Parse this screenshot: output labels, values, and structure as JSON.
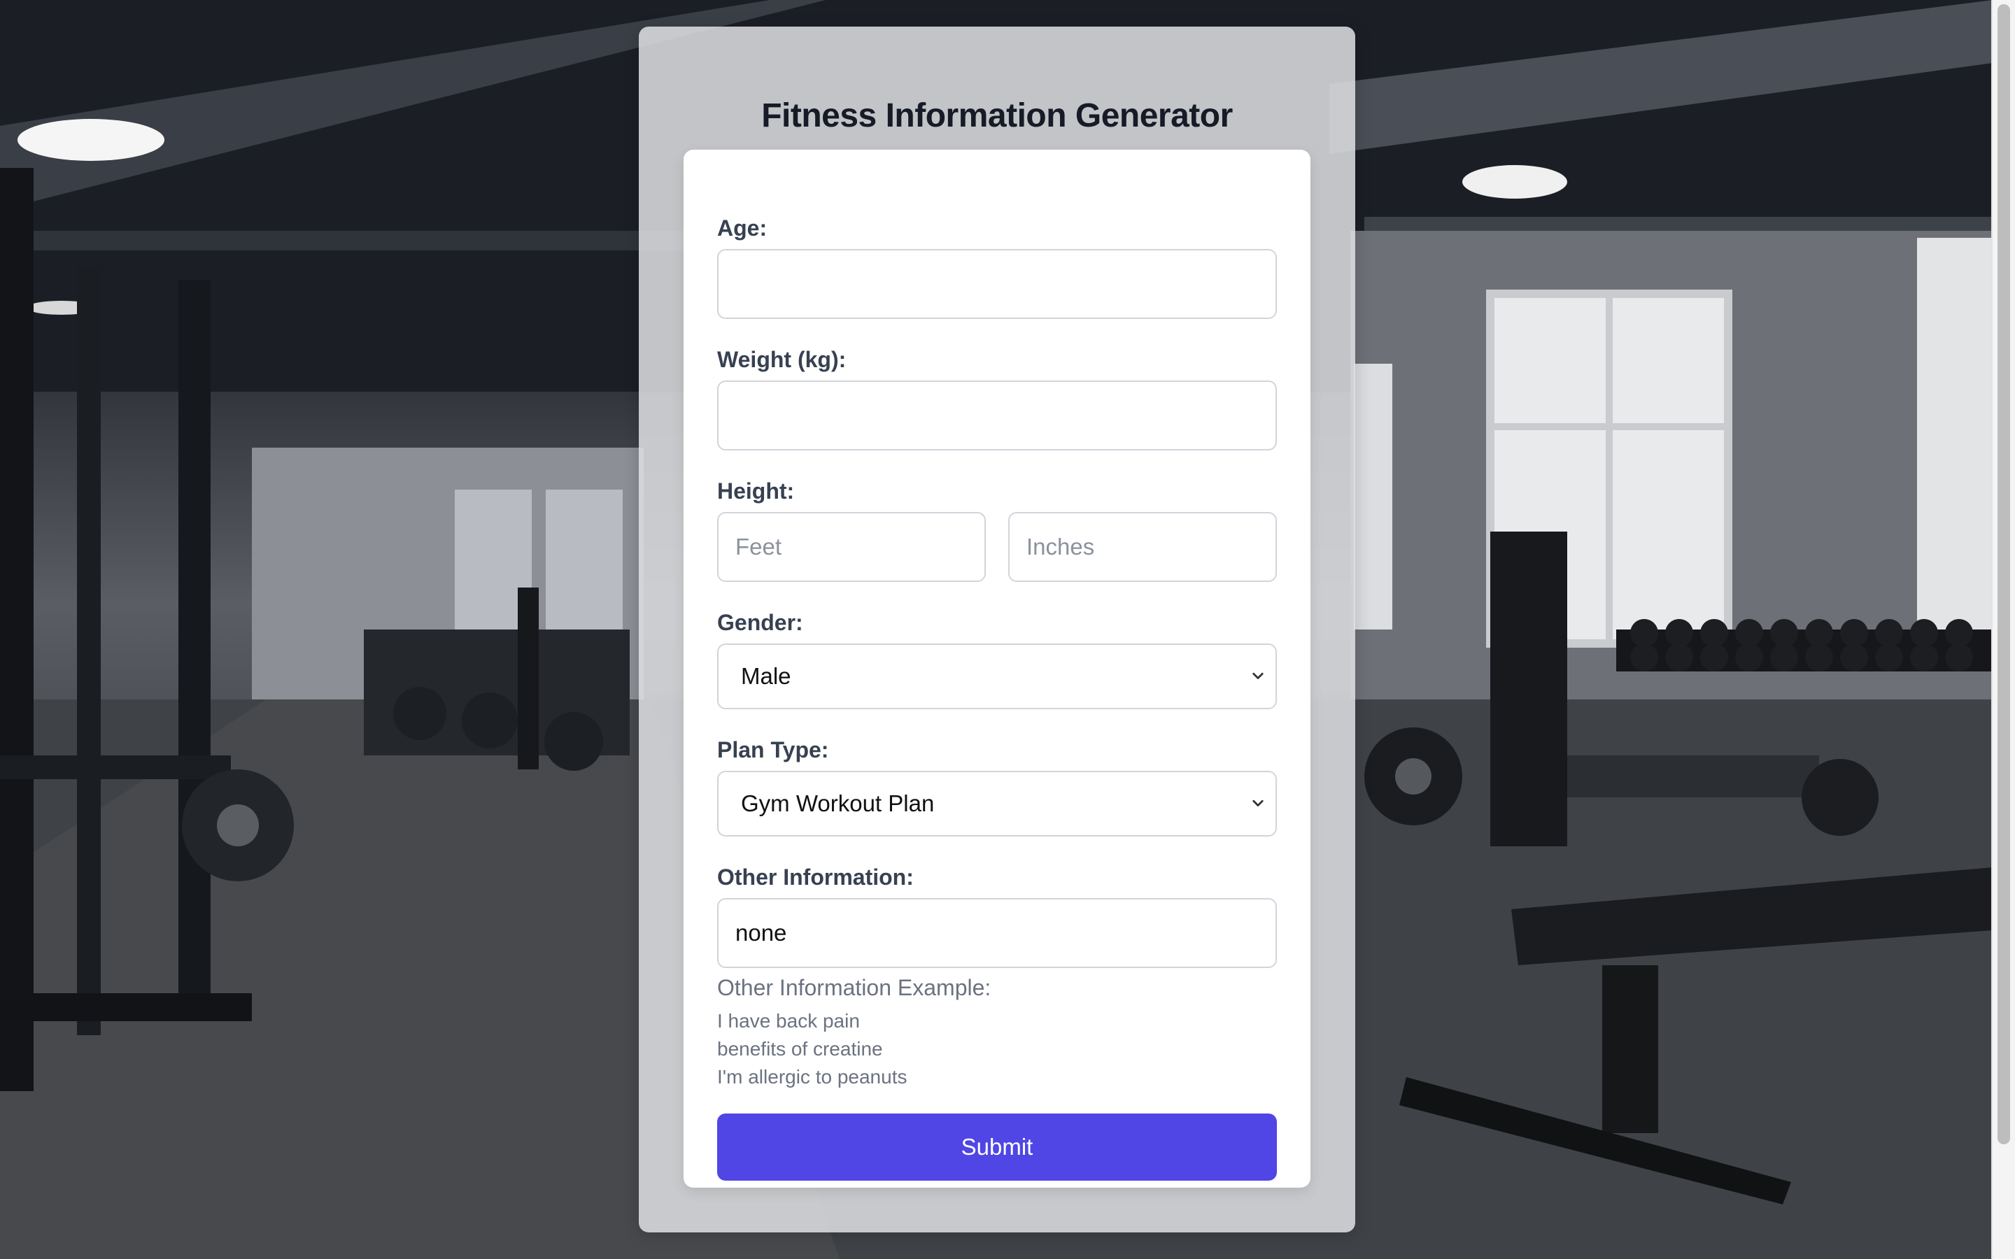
{
  "app": {
    "title": "Fitness Information Generator"
  },
  "form": {
    "age": {
      "label": "Age:",
      "value": ""
    },
    "weight": {
      "label": "Weight (kg):",
      "value": ""
    },
    "height": {
      "label": "Height:",
      "feet_placeholder": "Feet",
      "inches_placeholder": "Inches"
    },
    "gender": {
      "label": "Gender:",
      "selected": "Male"
    },
    "plan_type": {
      "label": "Plan Type:",
      "selected": "Gym Workout Plan"
    },
    "other": {
      "label": "Other Information:",
      "value": "none",
      "example_title": "Other Information Example:",
      "examples": [
        "I have back pain",
        "benefits of creatine",
        "I'm allergic to peanuts"
      ]
    },
    "submit_label": "Submit"
  },
  "colors": {
    "accent": "#4f46e5",
    "title": "#161b27",
    "label": "#374151",
    "hint": "#6b7280"
  },
  "icons": {
    "select_chevron": "chevron-down-icon"
  }
}
